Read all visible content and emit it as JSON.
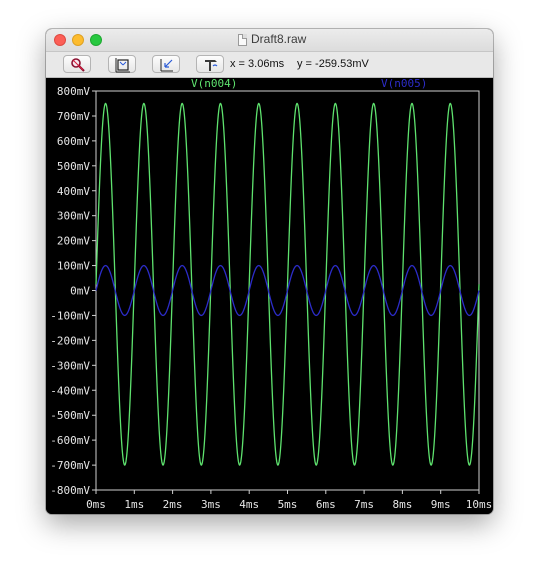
{
  "window": {
    "title": "Draft8.raw"
  },
  "toolbar": {
    "buttons": [
      {
        "icon": "zoom-magnifier-icon"
      },
      {
        "icon": "zoom-full-extents-icon"
      },
      {
        "icon": "zoom-back-icon"
      },
      {
        "icon": "autorange-icon"
      }
    ],
    "cursor_x": "x = 3.06ms",
    "cursor_y": "y = -259.53mV"
  },
  "chart_data": {
    "type": "line",
    "background": "#000000",
    "xlabel": "",
    "ylabel": "",
    "xlim": [
      0,
      10
    ],
    "ylim": [
      -800,
      800
    ],
    "xticks": [
      "0ms",
      "1ms",
      "2ms",
      "3ms",
      "4ms",
      "5ms",
      "6ms",
      "7ms",
      "8ms",
      "9ms",
      "10ms"
    ],
    "yticks": [
      "800mV",
      "700mV",
      "600mV",
      "500mV",
      "400mV",
      "300mV",
      "200mV",
      "100mV",
      "0mV",
      "-100mV",
      "-200mV",
      "-300mV",
      "-400mV",
      "-500mV",
      "-600mV",
      "-700mV",
      "-800mV"
    ],
    "grid": false,
    "series": [
      {
        "name": "V(n004)",
        "color": "#5ee26e",
        "waveform": "sine",
        "amplitude_mV": 725,
        "offset_mV": 25,
        "frequency_kHz": 1.0,
        "phase_deg": 0
      },
      {
        "name": "V(n005)",
        "color": "#2c2cc8",
        "waveform": "sine",
        "amplitude_mV": 100,
        "offset_mV": 0,
        "frequency_kHz": 1.0,
        "phase_deg": 0
      }
    ]
  }
}
